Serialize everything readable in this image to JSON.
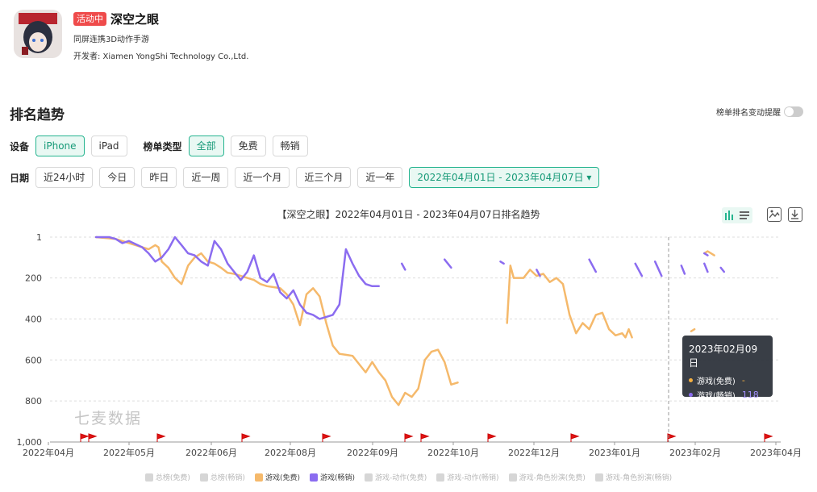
{
  "app": {
    "status_badge": "活动中",
    "name": "深空之眼",
    "subtitle": "同屏连携3D动作手游",
    "developer": "开发者: Xiamen YongShi Technology Co.,Ltd."
  },
  "section_title": "排名趋势",
  "alert_toggle_label": "榜单排名变动提醒",
  "filters": {
    "device_label": "设备",
    "devices": [
      "iPhone",
      "iPad"
    ],
    "device_selected": "iPhone",
    "list_type_label": "榜单类型",
    "list_types": [
      "全部",
      "免费",
      "畅销"
    ],
    "list_type_selected": "全部",
    "date_label": "日期",
    "date_presets": [
      "近24小时",
      "今日",
      "昨日",
      "近一周",
      "近一个月",
      "近三个月",
      "近一年"
    ],
    "date_range": "2022年04月01日 - 2023年04月07日 ▾"
  },
  "watermark": "七麦数据",
  "tooltip": {
    "date": "2023年02月09日",
    "rows": [
      {
        "label": "游戏(免费)",
        "value": "-",
        "color": "#f5b041"
      },
      {
        "label": "游戏(畅销)",
        "value": "118",
        "color": "#8b6cf0"
      }
    ]
  },
  "legend": [
    {
      "label": "总榜(免费)",
      "color": "#d6d6d6",
      "active": false
    },
    {
      "label": "总榜(畅销)",
      "color": "#d6d6d6",
      "active": false
    },
    {
      "label": "游戏(免费)",
      "color": "#f5b96b",
      "active": true
    },
    {
      "label": "游戏(畅销)",
      "color": "#8b6cf0",
      "active": true
    },
    {
      "label": "游戏-动作(免费)",
      "color": "#d6d6d6",
      "active": false
    },
    {
      "label": "游戏-动作(畅销)",
      "color": "#d6d6d6",
      "active": false
    },
    {
      "label": "游戏-角色扮演(免费)",
      "color": "#d6d6d6",
      "active": false
    },
    {
      "label": "游戏-角色扮演(畅销)",
      "color": "#d6d6d6",
      "active": false
    }
  ],
  "chart_data": {
    "type": "line",
    "title": "【深空之眼】2022年04月01日 - 2023年04月07日排名趋势",
    "x_ticks": [
      "2022年04月",
      "2022年05月",
      "2022年06月",
      "2022年08月",
      "2022年09月",
      "2022年10月",
      "2022年12月",
      "2023年01月",
      "2023年02月",
      "2023年04月"
    ],
    "y_ticks": [
      "1",
      "200",
      "400",
      "600",
      "800",
      "1,000"
    ],
    "ylim": [
      1,
      1000
    ],
    "y_inverted": true,
    "series": [
      {
        "name": "游戏(免费)",
        "color": "#f5b96b",
        "segments": [
          [
            [
              0.07,
              1
            ],
            [
              0.1,
              10
            ],
            [
              0.13,
              40
            ],
            [
              0.15,
              60
            ],
            [
              0.16,
              40
            ],
            [
              0.165,
              50
            ],
            [
              0.17,
              120
            ],
            [
              0.18,
              150
            ],
            [
              0.19,
              200
            ],
            [
              0.2,
              230
            ],
            [
              0.21,
              140
            ],
            [
              0.22,
              100
            ],
            [
              0.23,
              80
            ],
            [
              0.24,
              120
            ],
            [
              0.25,
              130
            ],
            [
              0.26,
              150
            ],
            [
              0.27,
              175
            ],
            [
              0.28,
              180
            ],
            [
              0.29,
              190
            ],
            [
              0.3,
              200
            ],
            [
              0.31,
              210
            ],
            [
              0.32,
              230
            ],
            [
              0.33,
              240
            ],
            [
              0.34,
              245
            ],
            [
              0.35,
              250
            ],
            [
              0.36,
              280
            ],
            [
              0.37,
              330
            ],
            [
              0.38,
              430
            ],
            [
              0.39,
              280
            ],
            [
              0.4,
              250
            ],
            [
              0.41,
              290
            ],
            [
              0.42,
              420
            ],
            [
              0.43,
              530
            ],
            [
              0.44,
              570
            ],
            [
              0.45,
              575
            ],
            [
              0.46,
              580
            ],
            [
              0.47,
              620
            ],
            [
              0.48,
              660
            ],
            [
              0.49,
              610
            ],
            [
              0.5,
              660
            ],
            [
              0.51,
              700
            ],
            [
              0.52,
              780
            ],
            [
              0.53,
              820
            ],
            [
              0.54,
              760
            ],
            [
              0.55,
              780
            ],
            [
              0.56,
              740
            ],
            [
              0.57,
              600
            ],
            [
              0.58,
              560
            ],
            [
              0.59,
              550
            ],
            [
              0.6,
              610
            ],
            [
              0.61,
              720
            ],
            [
              0.62,
              710
            ]
          ],
          [
            [
              0.695,
              420
            ],
            [
              0.7,
              140
            ],
            [
              0.705,
              200
            ],
            [
              0.72,
              200
            ],
            [
              0.73,
              160
            ],
            [
              0.74,
              190
            ],
            [
              0.75,
              180
            ],
            [
              0.76,
              220
            ],
            [
              0.77,
              200
            ],
            [
              0.78,
              230
            ],
            [
              0.79,
              380
            ],
            [
              0.8,
              470
            ],
            [
              0.81,
              420
            ],
            [
              0.82,
              450
            ],
            [
              0.83,
              380
            ],
            [
              0.84,
              370
            ],
            [
              0.85,
              450
            ],
            [
              0.86,
              480
            ],
            [
              0.87,
              470
            ],
            [
              0.875,
              490
            ],
            [
              0.88,
              450
            ],
            [
              0.885,
              490
            ]
          ],
          [
            [
              0.975,
              460
            ],
            [
              0.98,
              450
            ]
          ],
          [
            [
              0.995,
              80
            ],
            [
              1.0,
              70
            ],
            [
              1.01,
              90
            ]
          ]
        ]
      },
      {
        "name": "游戏(畅销)",
        "color": "#8b6cf0",
        "segments": [
          [
            [
              0.07,
              1
            ],
            [
              0.09,
              1
            ],
            [
              0.1,
              10
            ],
            [
              0.11,
              30
            ],
            [
              0.12,
              20
            ],
            [
              0.13,
              35
            ],
            [
              0.14,
              50
            ],
            [
              0.15,
              80
            ],
            [
              0.16,
              120
            ],
            [
              0.17,
              100
            ],
            [
              0.18,
              60
            ],
            [
              0.19,
              1
            ],
            [
              0.2,
              40
            ],
            [
              0.21,
              80
            ],
            [
              0.22,
              90
            ],
            [
              0.23,
              120
            ],
            [
              0.24,
              140
            ],
            [
              0.25,
              20
            ],
            [
              0.26,
              60
            ],
            [
              0.27,
              130
            ],
            [
              0.28,
              170
            ],
            [
              0.29,
              210
            ],
            [
              0.3,
              170
            ],
            [
              0.31,
              90
            ],
            [
              0.32,
              200
            ],
            [
              0.33,
              220
            ],
            [
              0.34,
              180
            ],
            [
              0.35,
              270
            ],
            [
              0.36,
              300
            ],
            [
              0.37,
              260
            ],
            [
              0.38,
              330
            ],
            [
              0.39,
              370
            ],
            [
              0.4,
              380
            ],
            [
              0.41,
              400
            ],
            [
              0.42,
              390
            ],
            [
              0.43,
              380
            ],
            [
              0.44,
              330
            ],
            [
              0.45,
              60
            ],
            [
              0.46,
              130
            ],
            [
              0.47,
              190
            ],
            [
              0.48,
              230
            ],
            [
              0.49,
              240
            ],
            [
              0.5,
              240
            ]
          ],
          [
            [
              0.535,
              130
            ],
            [
              0.54,
              160
            ]
          ],
          [
            [
              0.6,
              110
            ],
            [
              0.61,
              150
            ]
          ],
          [
            [
              0.685,
              120
            ],
            [
              0.69,
              130
            ]
          ],
          [
            [
              0.74,
              160
            ],
            [
              0.745,
              190
            ]
          ],
          [
            [
              0.82,
              110
            ],
            [
              0.83,
              170
            ]
          ],
          [
            [
              0.89,
              130
            ],
            [
              0.9,
              190
            ]
          ],
          [
            [
              0.92,
              120
            ],
            [
              0.93,
              190
            ]
          ],
          [
            [
              0.96,
              140
            ],
            [
              0.965,
              180
            ]
          ],
          [
            [
              0.995,
              130
            ],
            [
              1.0,
              170
            ]
          ],
          [
            [
              1.02,
              150
            ],
            [
              1.025,
              170
            ]
          ],
          [
            [
              0.995,
              80
            ],
            [
              1.0,
              90
            ]
          ]
        ]
      }
    ]
  }
}
